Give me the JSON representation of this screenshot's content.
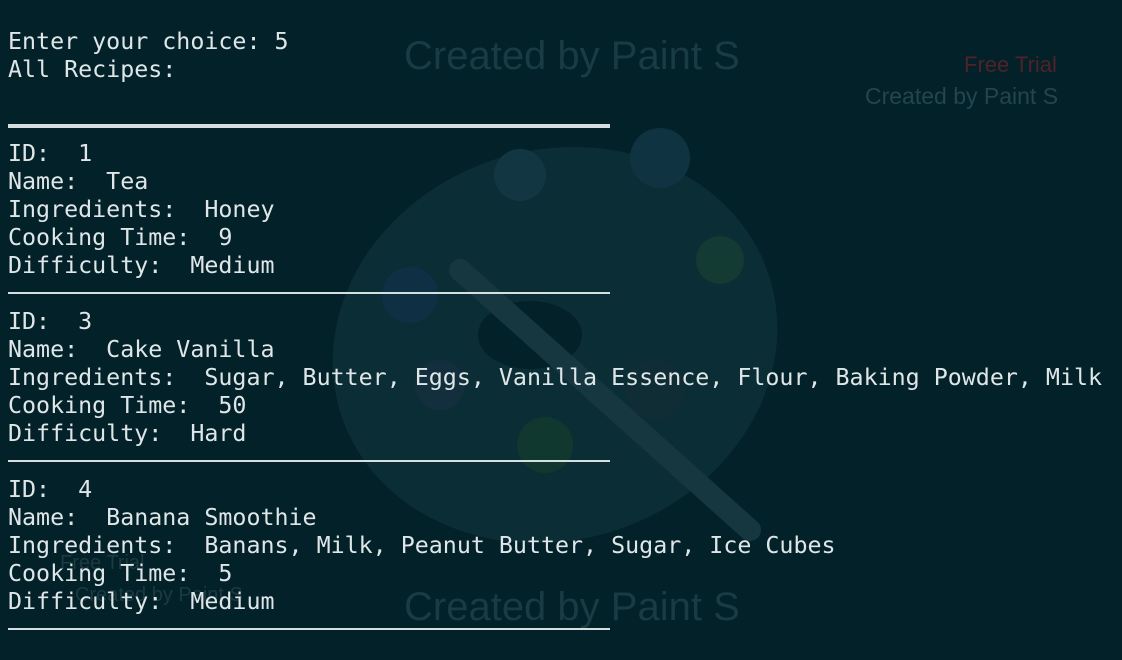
{
  "terminal": {
    "prompt": "Enter your choice: 5",
    "heading": "All Recipes:",
    "recipes": [
      {
        "id": "ID:  1",
        "name": "Name:  Tea",
        "ingredients": "Ingredients:  Honey",
        "cooking_time": "Cooking Time:  9",
        "difficulty": "Difficulty:  Medium"
      },
      {
        "id": "ID:  3",
        "name": "Name:  Cake Vanilla",
        "ingredients": "Ingredients:  Sugar, Butter, Eggs, Vanilla Essence, Flour, Baking Powder, Milk",
        "cooking_time": "Cooking Time:  50",
        "difficulty": "Difficulty:  Hard"
      },
      {
        "id": "ID:  4",
        "name": "Name:  Banana Smoothie",
        "ingredients": "Ingredients:  Banans, Milk, Peanut Butter, Sugar, Ice Cubes",
        "cooking_time": "Cooking Time:  5",
        "difficulty": "Difficulty:  Medium"
      }
    ]
  },
  "watermark": {
    "created_by": "Created by Paint S",
    "free_trial": "Free Trial",
    "icon": "paint-palette-icon"
  },
  "colors": {
    "background": "#032129",
    "text": "#dfe6e8",
    "watermark_text": "#183b44",
    "trial_text": "#51212a"
  }
}
